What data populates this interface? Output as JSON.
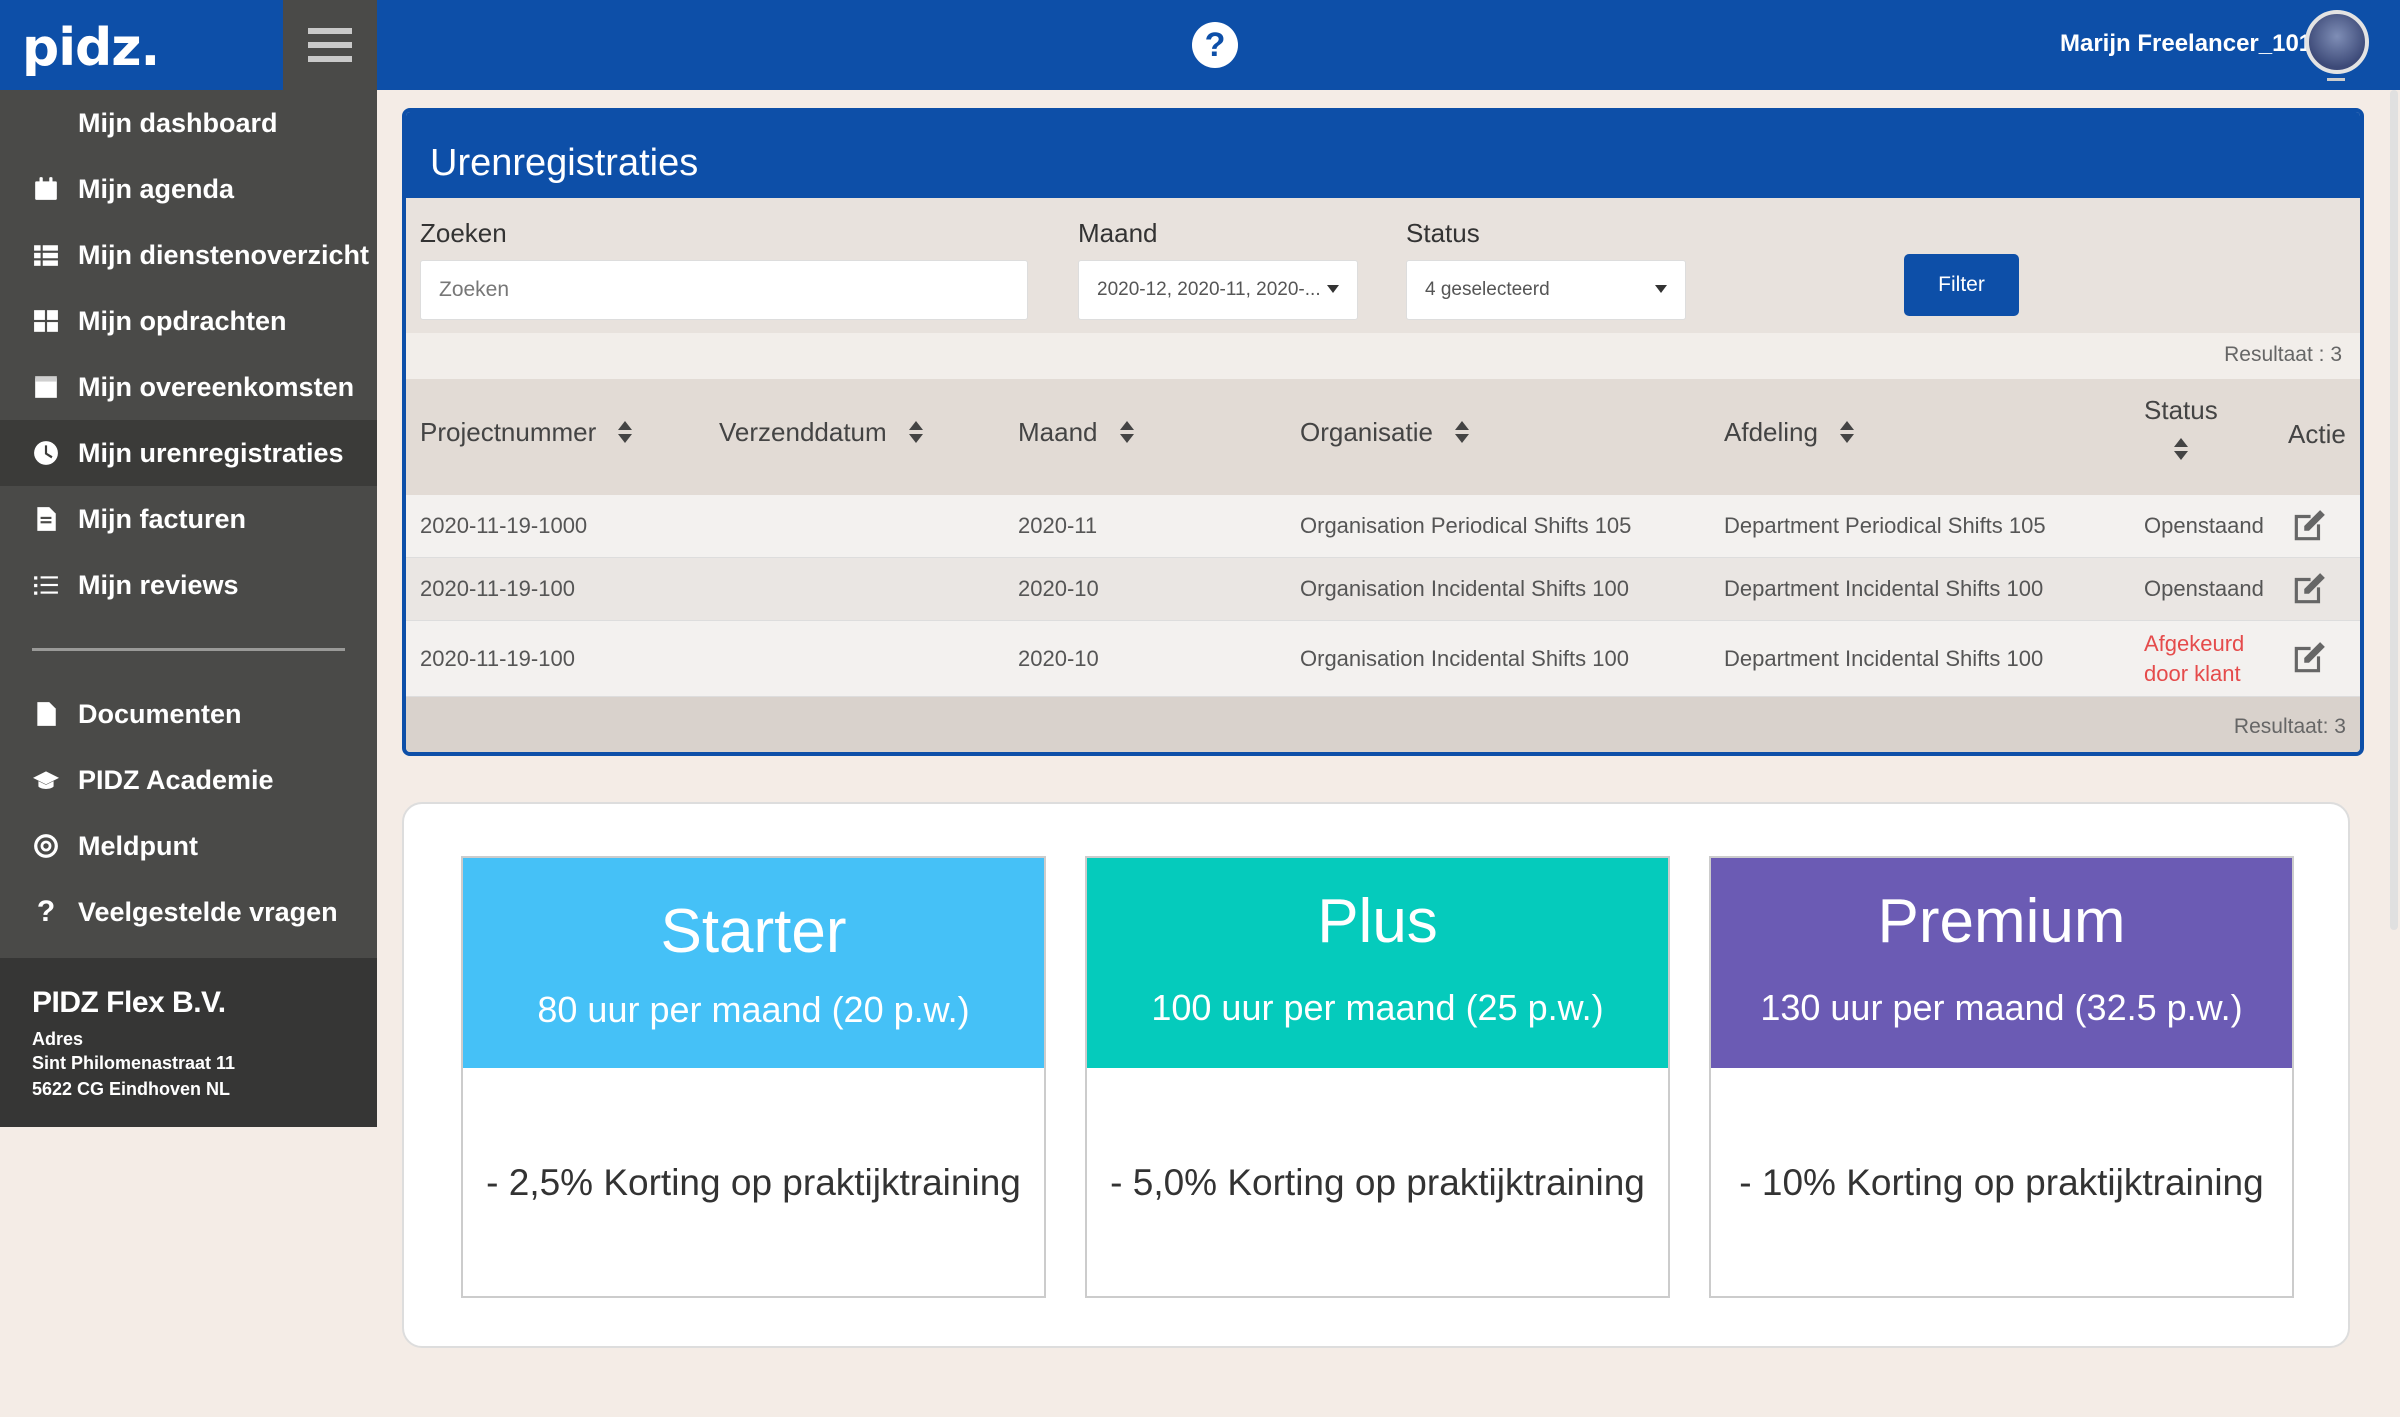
{
  "logo": "pidz.",
  "topbar": {
    "help_symbol": "?",
    "user_name": "Marijn Freelancer_101"
  },
  "sidebar": {
    "items": [
      {
        "label": "Mijn dashboard",
        "icon": "none"
      },
      {
        "label": "Mijn agenda",
        "icon": "calendar-icon"
      },
      {
        "label": "Mijn dienstenoverzicht",
        "icon": "list-icon"
      },
      {
        "label": "Mijn opdrachten",
        "icon": "grid-icon"
      },
      {
        "label": "Mijn overeenkomsten",
        "icon": "calendar-icon"
      },
      {
        "label": "Mijn urenregistraties",
        "icon": "clock-icon",
        "active": true
      },
      {
        "label": "Mijn facturen",
        "icon": "file-icon"
      },
      {
        "label": "Mijn reviews",
        "icon": "list-ol-icon"
      }
    ],
    "secondary": [
      {
        "label": "Documenten",
        "icon": "document-icon"
      },
      {
        "label": "PIDZ Academie",
        "icon": "graduation-cap-icon"
      },
      {
        "label": "Meldpunt",
        "icon": "target-icon"
      },
      {
        "label": "Veelgestelde vragen",
        "icon": "question-icon"
      }
    ],
    "company": {
      "name": "PIDZ Flex B.V.",
      "address_label": "Adres",
      "street": "Sint Philomenastraat 11",
      "city": "5622 CG Eindhoven NL"
    }
  },
  "panel": {
    "title": "Urenregistraties",
    "filters": {
      "search_label": "Zoeken",
      "search_placeholder": "Zoeken",
      "month_label": "Maand",
      "month_value": "2020-12, 2020-11, 2020-...",
      "status_label": "Status",
      "status_value": "4 geselecteerd",
      "filter_button": "Filter"
    },
    "result_top": "Resultaat : 3",
    "result_bottom": "Resultaat: 3",
    "columns": [
      "Projectnummer",
      "Verzenddatum",
      "Maand",
      "Organisatie",
      "Afdeling",
      "Status",
      "Actie"
    ],
    "rows": [
      {
        "project": "2020-11-19-1000",
        "sent": "",
        "month": "2020-11",
        "org": "Organisation Periodical Shifts 105",
        "dept": "Department Periodical Shifts 105",
        "status": "Openstaand",
        "status_line2": ""
      },
      {
        "project": "2020-11-19-100",
        "sent": "",
        "month": "2020-10",
        "org": "Organisation Incidental Shifts 100",
        "dept": "Department Incidental Shifts 100",
        "status": "Openstaand",
        "status_line2": ""
      },
      {
        "project": "2020-11-19-100",
        "sent": "",
        "month": "2020-10",
        "org": "Organisation Incidental Shifts 100",
        "dept": "Department Incidental Shifts 100",
        "status": "Afgekeurd",
        "status_line2": "door klant"
      }
    ]
  },
  "plans": [
    {
      "name": "Starter",
      "hours": "80 uur per maand (20 p.w.)",
      "discount": "- 2,5% Korting op praktijktraining",
      "color": "#45c1f7"
    },
    {
      "name": "Plus",
      "hours": "100 uur per maand (25 p.w.)",
      "discount": "- 5,0% Korting op praktijktraining",
      "color": "#05cbbc"
    },
    {
      "name": "Premium",
      "hours": "130 uur per maand (32.5 p.w.)",
      "discount": "- 10% Korting op praktijktraining",
      "color": "#6b5bb4"
    }
  ],
  "colors": {
    "brand_blue": "#0d4fa8",
    "sidebar": "#4a4a48",
    "rejected": "#e54b4b"
  }
}
